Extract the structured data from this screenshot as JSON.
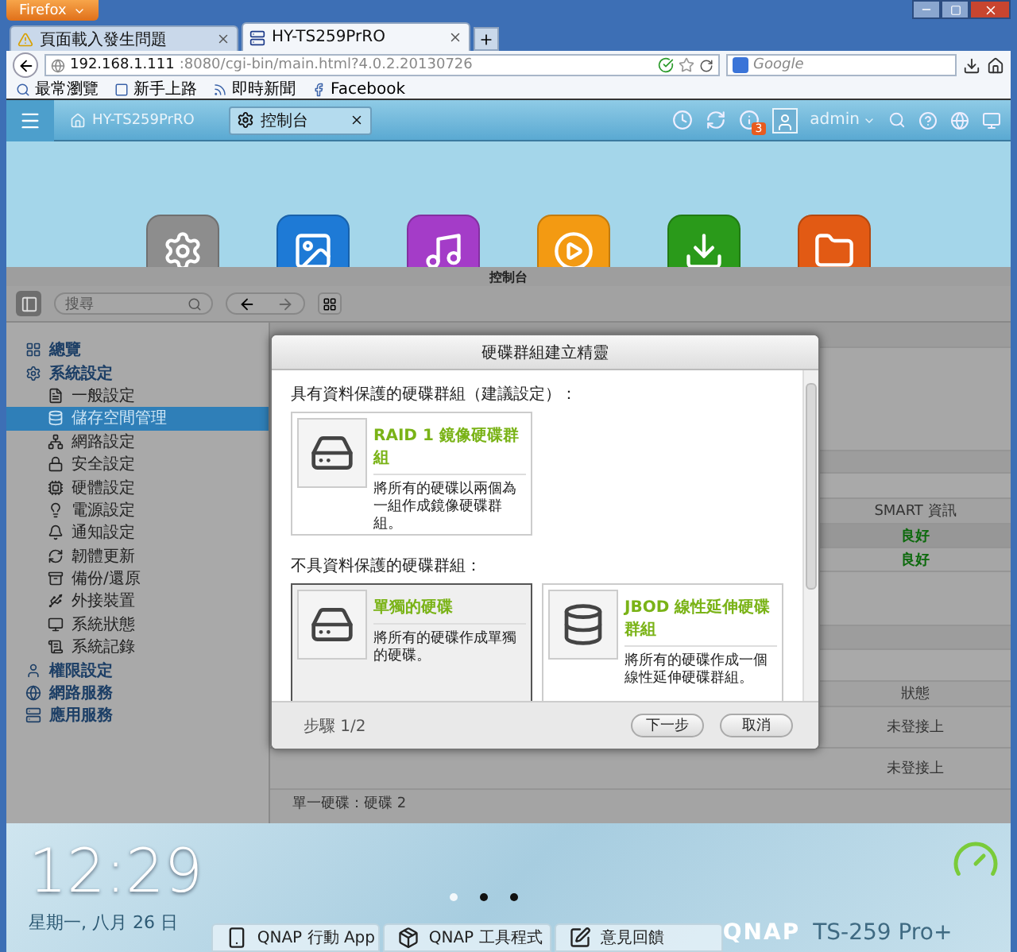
{
  "browser": {
    "menu_button": "Firefox",
    "tabs": [
      {
        "title": "頁面載入發生問題",
        "selected": false
      },
      {
        "title": "HY-TS259PrRO",
        "selected": true
      }
    ],
    "address": {
      "host": "192.168.1.111",
      "path": ":8080/cgi-bin/main.html?4.0.2.20130726"
    },
    "search": {
      "placeholder": "Google"
    },
    "bookmarks": [
      "最常瀏覽",
      "新手上路",
      "即時新聞",
      "Facebook"
    ]
  },
  "app_header": {
    "device_name": "HY-TS259PrRO",
    "tab": "控制台",
    "notification_count": "3",
    "user": "admin"
  },
  "control_panel": {
    "title": "控制台",
    "search": {
      "placeholder": "搜尋"
    },
    "sidebar": {
      "items": [
        {
          "label": "總覽",
          "selected": false
        },
        {
          "label": "系統設定",
          "selected": false,
          "children": [
            {
              "label": "一般設定",
              "selected": false
            },
            {
              "label": "儲存空間管理",
              "selected": true
            },
            {
              "label": "網路設定",
              "selected": false
            },
            {
              "label": "安全設定",
              "selected": false
            },
            {
              "label": "硬體設定",
              "selected": false
            },
            {
              "label": "電源設定",
              "selected": false
            },
            {
              "label": "通知設定",
              "selected": false
            },
            {
              "label": "韌體更新",
              "selected": false
            },
            {
              "label": "備份/還原",
              "selected": false
            },
            {
              "label": "外接裝置",
              "selected": false
            },
            {
              "label": "系統狀態",
              "selected": false
            },
            {
              "label": "系統記錄",
              "selected": false
            }
          ]
        },
        {
          "label": "權限設定",
          "selected": false
        },
        {
          "label": "網路服務",
          "selected": false
        },
        {
          "label": "應用服務",
          "selected": false
        }
      ]
    },
    "background_table": {
      "header_1": "SMART 資訊",
      "column_1": [
        "良好",
        "良好"
      ],
      "header_2": "狀態",
      "column_2": [
        "未登接上",
        "未登接上"
      ],
      "footer_row": "單一硬碟：硬碟 2"
    }
  },
  "dialog": {
    "title": "硬碟群組建立精靈",
    "sections": [
      {
        "heading": "具有資料保護的硬碟群組（建議設定）：",
        "cards": [
          {
            "title": "RAID 1 鏡像硬碟群組",
            "description": "將所有的硬碟以兩個為一組作成鏡像硬碟群組。",
            "selected": false
          }
        ]
      },
      {
        "heading": "不具資料保護的硬碟群組：",
        "cards": [
          {
            "title": "單獨的硬碟",
            "description": "將所有的硬碟作成單獨的硬碟。",
            "selected": true
          },
          {
            "title": "JBOD 線性延伸硬碟群組",
            "description": "將所有的硬碟作成一個線性延伸硬碟群組。",
            "selected": false
          }
        ]
      }
    ],
    "step": "步驟 1/2",
    "buttons": [
      "下一步",
      "取消"
    ]
  },
  "dock": {
    "time": "12:29",
    "date": "星期一, 八月 26 日",
    "page_dots": [
      {
        "selected": true
      },
      {
        "selected": false
      },
      {
        "selected": false
      }
    ],
    "shortcuts": [
      "QNAP 行動 App",
      "QNAP 工具程式",
      "意見回饋"
    ],
    "brand": "QNAP",
    "model": "TS-259 Pro+"
  }
}
